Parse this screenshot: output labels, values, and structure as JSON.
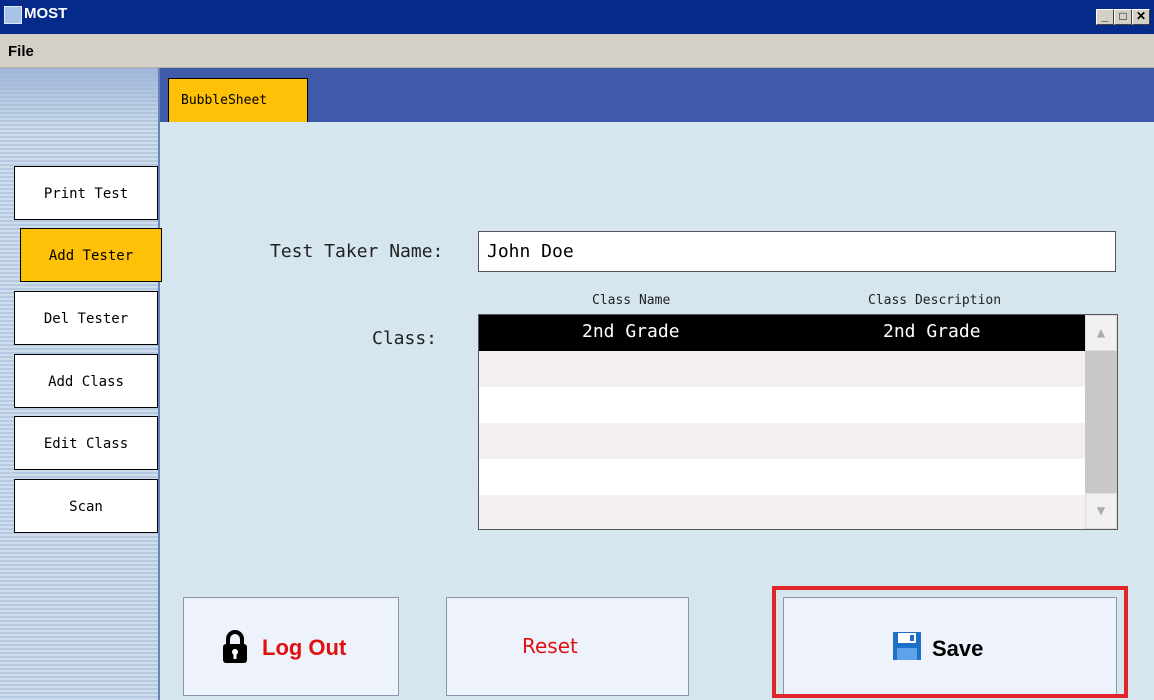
{
  "window": {
    "title": "MOST",
    "minimize": "_",
    "maximize": "□",
    "close": "✕"
  },
  "menu": {
    "file": "File"
  },
  "sidebar": {
    "items": [
      {
        "label": "Print Test"
      },
      {
        "label": "Add Tester"
      },
      {
        "label": "Del Tester"
      },
      {
        "label": "Add Class"
      },
      {
        "label": "Edit Class"
      },
      {
        "label": "Scan"
      }
    ],
    "active_index": 1
  },
  "tabs": [
    {
      "label": "BubbleSheet"
    }
  ],
  "form": {
    "name_label": "Test Taker Name:",
    "name_value": "John Doe",
    "class_label": "Class:"
  },
  "class_table": {
    "headers": [
      "Class Name",
      "Class Description"
    ],
    "rows": [
      {
        "name": "2nd Grade",
        "description": "2nd Grade"
      }
    ]
  },
  "buttons": {
    "logout": "Log Out",
    "reset": "Reset",
    "save": "Save"
  },
  "colors": {
    "accent": "#ffc107",
    "titlebar": "#062a8a",
    "tabstrip": "#3f5aa8",
    "content_bg": "#d6e6ee",
    "highlight": "#e0262b",
    "danger_text": "#e01010"
  },
  "icons": {
    "logout": "padlock-icon",
    "save": "floppy-disk-icon"
  }
}
